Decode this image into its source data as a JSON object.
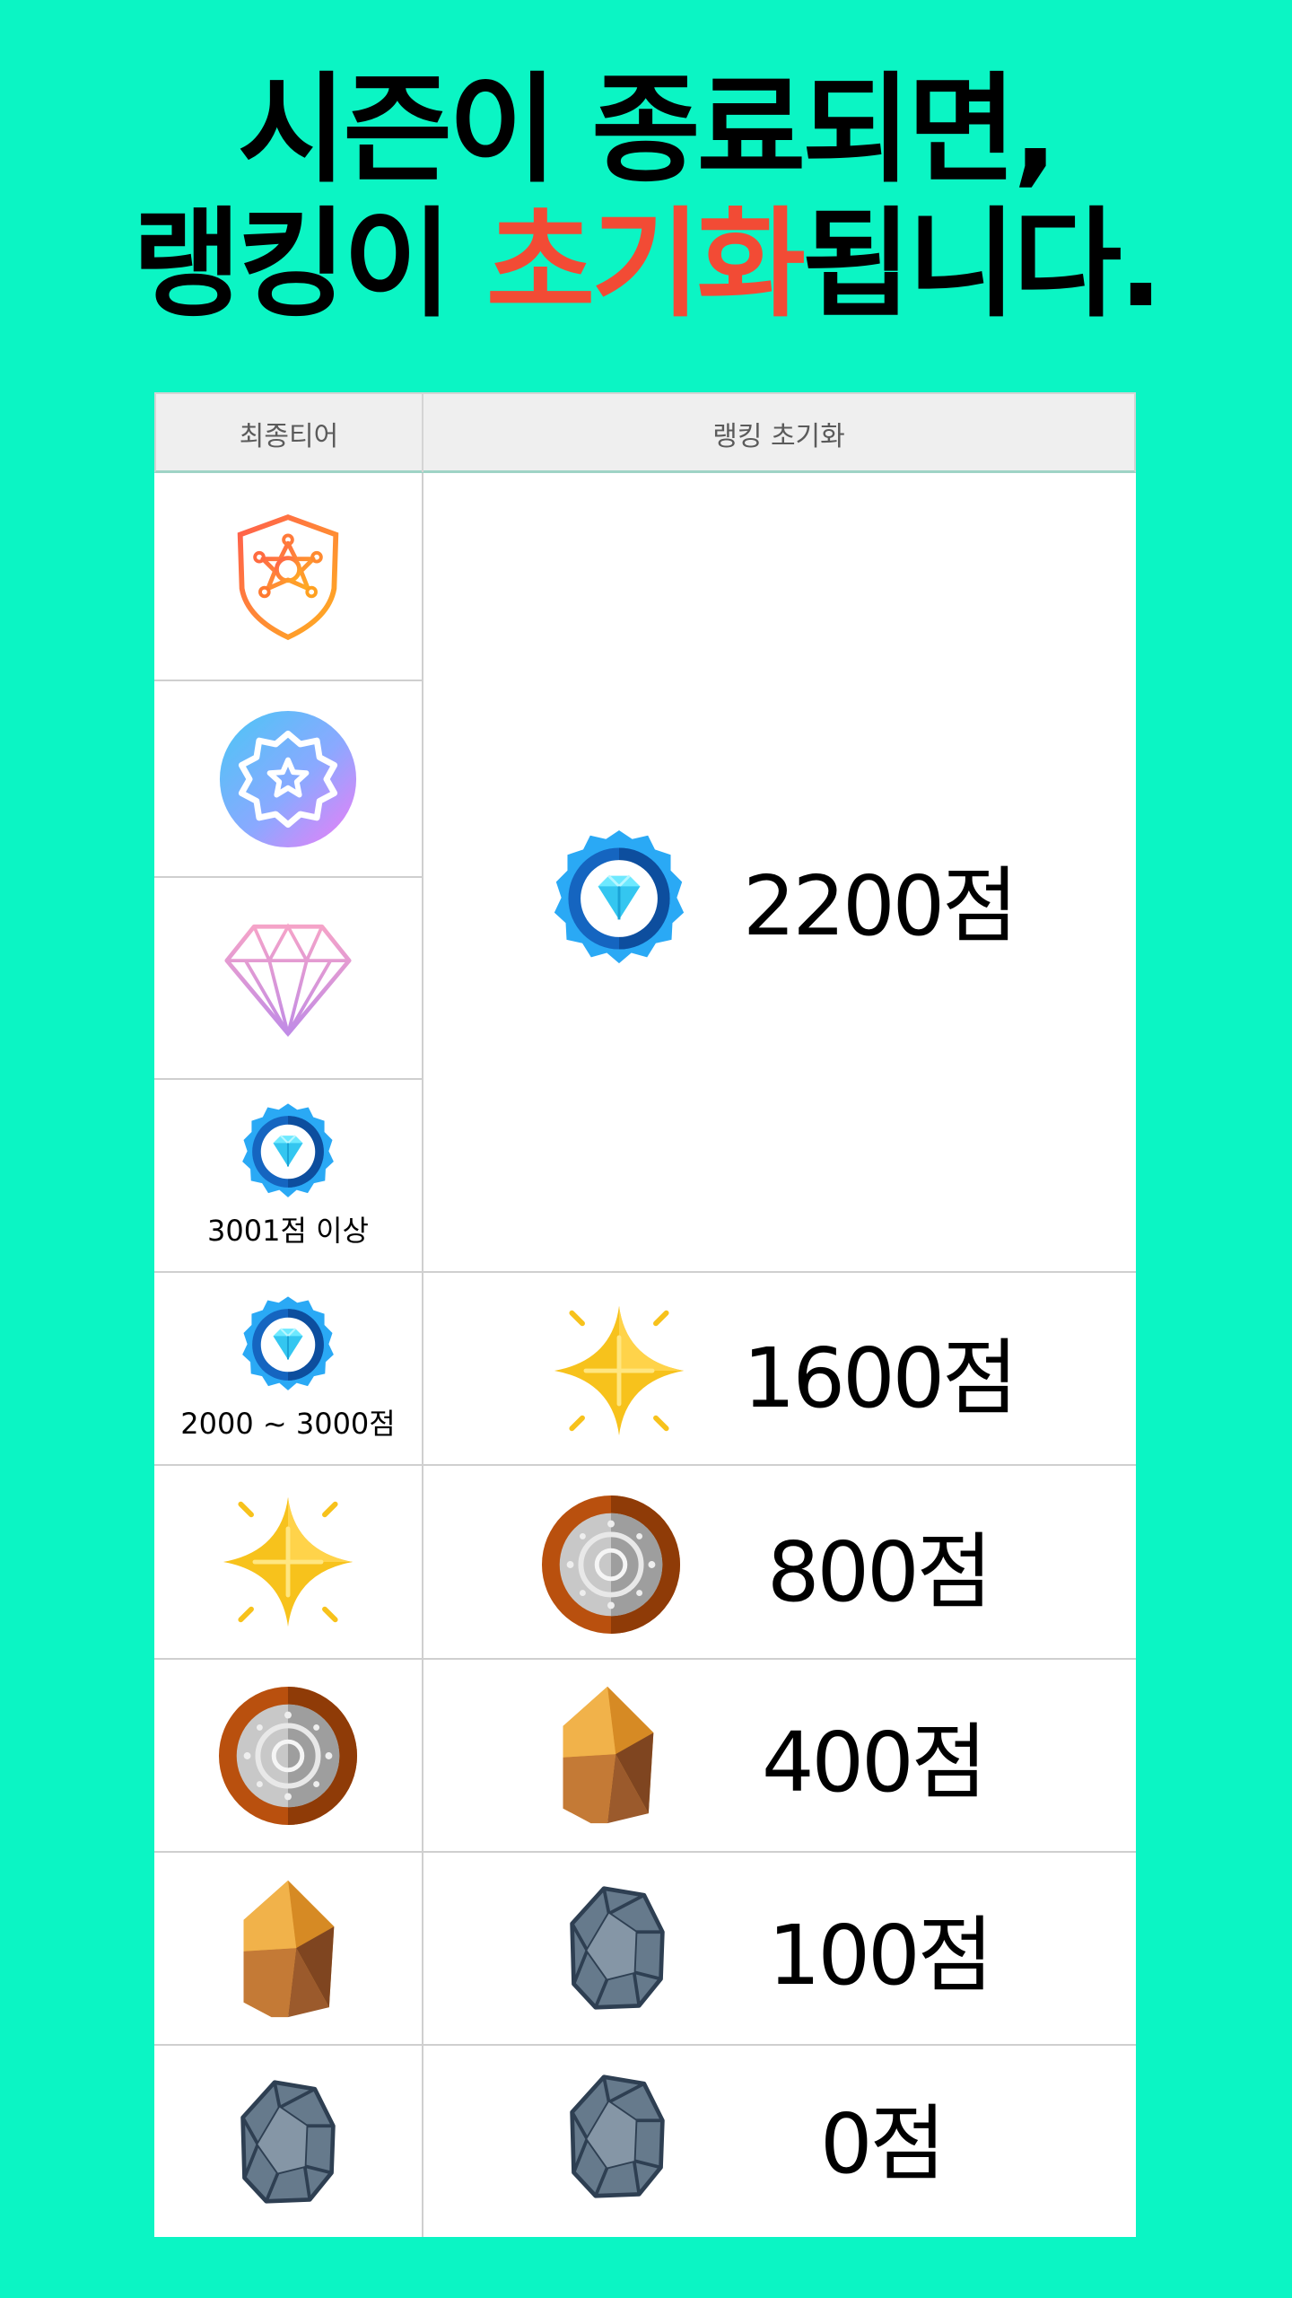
{
  "headline": {
    "line1": "시즌이 종료되면,",
    "line2_before": "랭킹이 ",
    "line2_accent": "초기화",
    "line2_after": "됩니다.",
    "accent_color": "#f24b35"
  },
  "background_color": "#0bf5c4",
  "table": {
    "headers": [
      "최종티어",
      "랭킹 초기화"
    ],
    "final_tiers": [
      {
        "icon": "sheriff-shield-icon",
        "caption": ""
      },
      {
        "icon": "gradient-star-badge-icon",
        "caption": ""
      },
      {
        "icon": "pink-diamond-outline-icon",
        "caption": ""
      },
      {
        "icon": "blue-diamond-badge-icon",
        "caption": "3001점 이상"
      },
      {
        "icon": "blue-diamond-badge-icon",
        "caption": "2000 ~ 3000점"
      },
      {
        "icon": "gold-sparkle-star-icon",
        "caption": ""
      },
      {
        "icon": "bronze-silver-coin-icon",
        "caption": ""
      },
      {
        "icon": "amber-crystal-icon",
        "caption": ""
      },
      {
        "icon": "gray-rock-icon",
        "caption": ""
      }
    ],
    "resets": [
      {
        "icon": "blue-diamond-badge-icon",
        "points": "2200점"
      },
      {
        "icon": "gold-sparkle-star-icon",
        "points": "1600점"
      },
      {
        "icon": "bronze-silver-coin-icon",
        "points": "800점"
      },
      {
        "icon": "amber-crystal-icon",
        "points": "400점"
      },
      {
        "icon": "gray-rock-icon",
        "points": "100점"
      },
      {
        "icon": "gray-rock-icon",
        "points": "0점"
      }
    ]
  }
}
